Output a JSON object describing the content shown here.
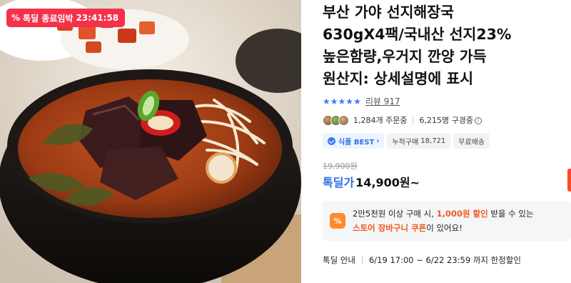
{
  "badge": {
    "icon": "percent-icon",
    "label": "톡딜 종료임박",
    "countdown": "23:41:58",
    "color": "#f5314c"
  },
  "title_lines": [
    "부산 가야 선지해장국",
    "630gX4팩/국내산 선지23%",
    "높은함량,우거지 깐양 가득",
    "원산지: 상세설명에 표시"
  ],
  "rating": {
    "stars": 5,
    "review_label": "리뷰 917",
    "star_color": "#3d7bf5"
  },
  "stats": {
    "orders": "1,284개 주문중",
    "watchers": "6,215명 구경중"
  },
  "tags": {
    "best": "식품 BEST",
    "cumulative_label": "누적구매",
    "cumulative_value": "18,721",
    "shipping": "무료배송"
  },
  "price": {
    "original": "19,900원",
    "deal_label": "톡딜가",
    "deal_value": "14,900원~",
    "accent": "#2f6fe8"
  },
  "coupon": {
    "icon_label": "%",
    "line1_a": "2만5천원 이상 구매 시, ",
    "line1_amount": "1,000원 할인",
    "line1_b": " 받을 수 있는",
    "line2_hl": "스토어 장바구니 쿠폰",
    "line2_b": "이 있어요!",
    "highlight_color": "#f05a1e"
  },
  "deal_info": {
    "label": "톡딜 안내",
    "period": "6/19 17:00 ~ 6/22 23:59 까지 한정할인"
  }
}
